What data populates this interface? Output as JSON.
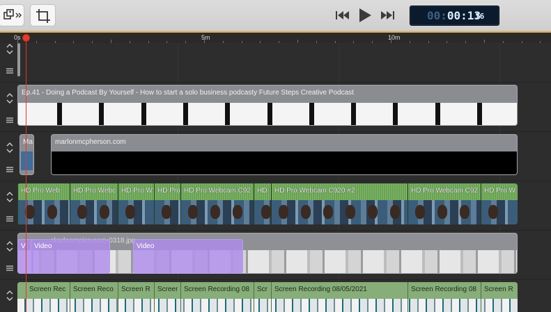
{
  "timecode": {
    "dim": "00:",
    "lit": "00:13",
    "frames": "16"
  },
  "ruler": {
    "labels": [
      "0s",
      "5m",
      "10m"
    ]
  },
  "tracks": {
    "podcast_audio": {
      "title": "Ep.41 - Doing a Podcast By Yourself - How to start a solo business podcasty Future Steps Creative Podcast"
    },
    "website": {
      "small_label": "Ma",
      "title": "marlonmcpherson.com"
    },
    "webcam": {
      "segments": [
        "HD Pro Web",
        "HD Pro Webc",
        "HD Pro W",
        "HD Pro",
        "HD Pro Webcam C92",
        "HD",
        "HD Pro Webcam C920 #2",
        "HD Pro Webcam C92",
        "HD Pro W"
      ]
    },
    "images": {
      "under_label": "...ckadoompics-com-0318.jpg",
      "video_label_a": "Video",
      "video_label_b": "Video",
      "video_label_c": "Vi"
    },
    "screen": {
      "segments": [
        "Screen Rec",
        "Screen Reco",
        "Screen R",
        "Screer",
        "Screen Recording 08",
        "Scr",
        "Screen Recording 08/05/2021",
        "Screen Recording 08",
        "Screen R"
      ]
    }
  },
  "colors": {
    "playhead": "#e03a2f",
    "ruler_accent": "#e3b24f",
    "audio_clip": "#6fa45a",
    "image_overlay": "#af8ceb"
  }
}
